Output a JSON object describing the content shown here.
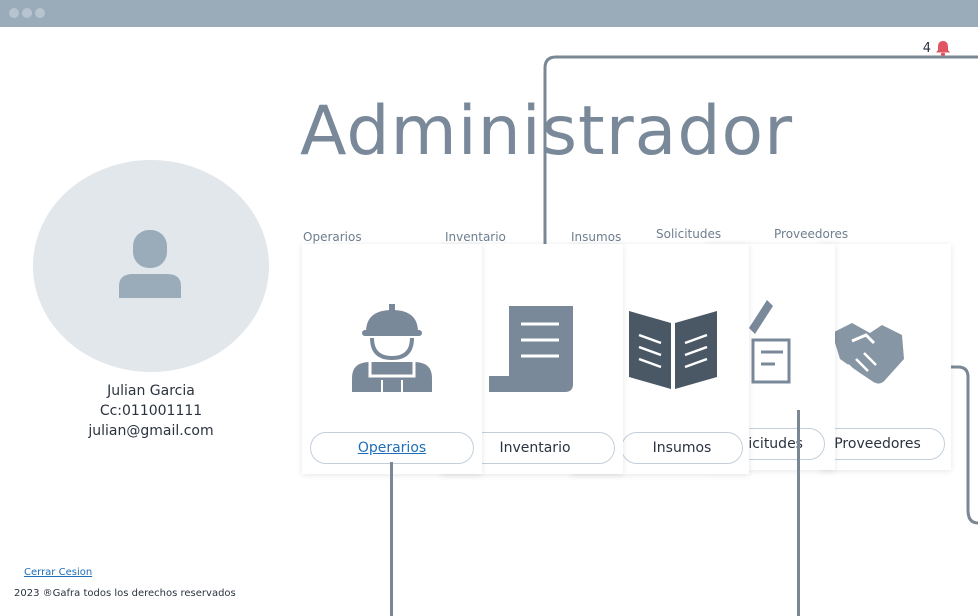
{
  "window": {
    "dots": 3
  },
  "notifications": {
    "count": "4",
    "icon": "bell-icon",
    "color": "#e05563"
  },
  "page": {
    "title": "Administrador"
  },
  "user": {
    "name": "Julian Garcia",
    "document": "Cc:011001111",
    "email": "julian@gmail.com",
    "avatar_icon": "user-icon"
  },
  "categories": {
    "operarios": {
      "label": "Operarios",
      "button": "Operarios",
      "icon": "worker-icon"
    },
    "inventario": {
      "label": "Inventario",
      "button": "Inventario",
      "icon": "scroll-document-icon"
    },
    "insumos": {
      "label": "Insumos",
      "button": "Insumos",
      "icon": "open-book-icon"
    },
    "solicitudes": {
      "label": "Solicitudes",
      "button": "Solicitudes",
      "icon": "edit-document-icon"
    },
    "proveedores": {
      "label": "Proveedores",
      "button": "Proveedores",
      "icon": "handshake-icon"
    }
  },
  "colors": {
    "accent": "#1f6fb8",
    "icon": "#7a8999",
    "dark_icon": "#4a5866"
  },
  "footer": {
    "logout": "Cerrar Cesion",
    "copyright": "2023 ®Gafra todos los derechos reservados"
  }
}
